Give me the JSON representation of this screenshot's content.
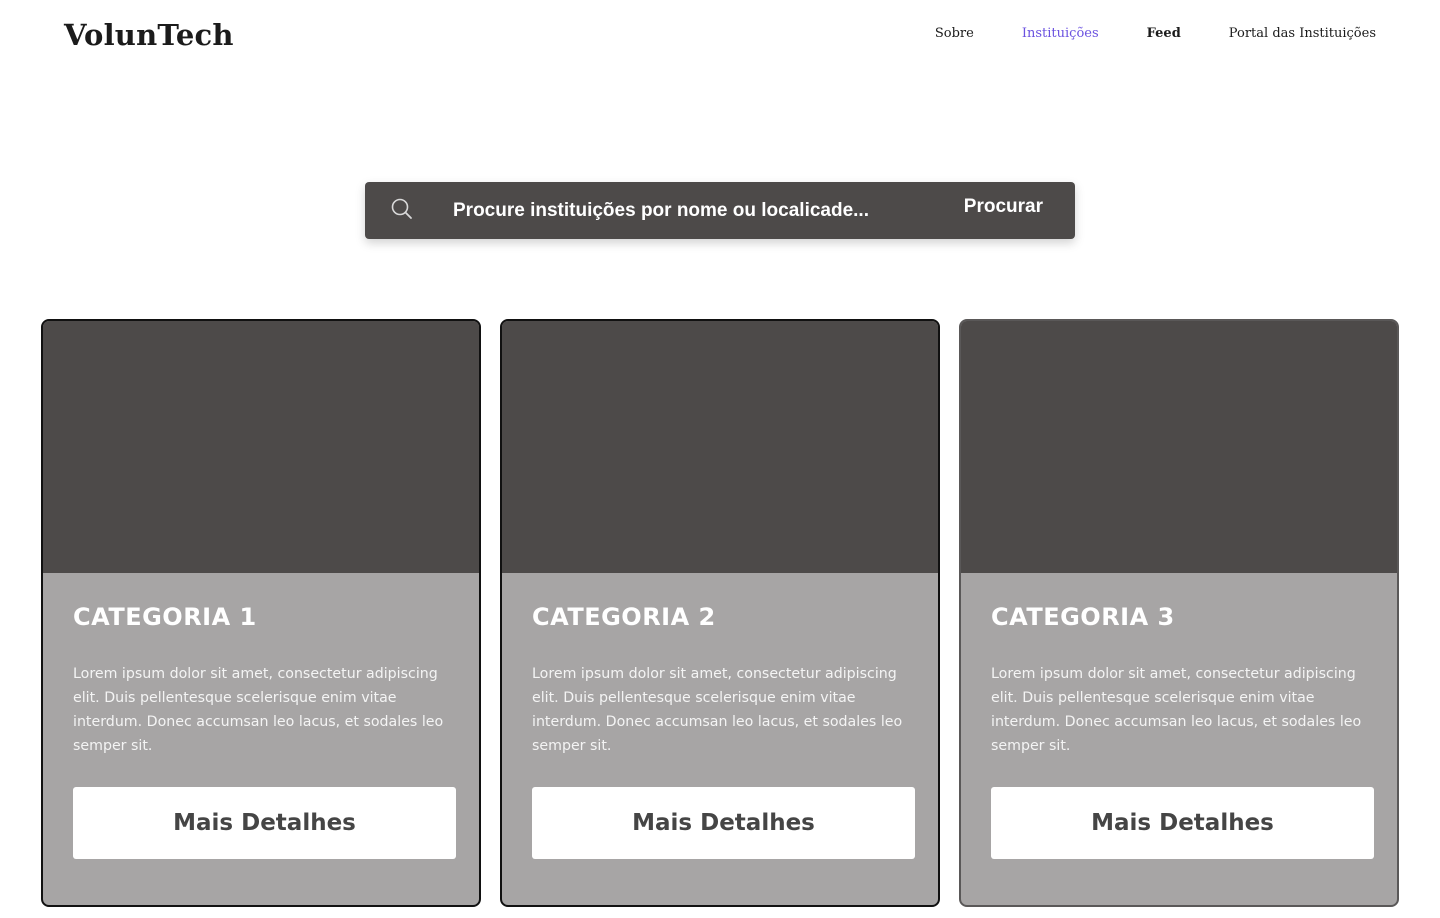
{
  "header": {
    "logo": "VolunTech",
    "nav": [
      {
        "label": "Sobre"
      },
      {
        "label": "Instituições"
      },
      {
        "label": "Feed"
      },
      {
        "label": "Portal das Instituições"
      }
    ]
  },
  "search": {
    "icon": "search-icon",
    "placeholder": "Procure instituições por nome ou localicade...",
    "button_label": "Procurar"
  },
  "cards": [
    {
      "title": "CATEGORIA 1",
      "text": "Lorem ipsum dolor sit amet, consectetur adipiscing elit. Duis  pellentesque scelerisque enim vitae interdum. Donec accumsan leo lacus,  et sodales leo semper sit.",
      "button_label": "Mais Detalhes"
    },
    {
      "title": "CATEGORIA 2",
      "text": "Lorem ipsum dolor sit amet, consectetur adipiscing elit. Duis  pellentesque scelerisque enim vitae interdum. Donec accumsan leo lacus,  et sodales leo semper sit.",
      "button_label": "Mais Detalhes"
    },
    {
      "title": "CATEGORIA 3",
      "text": "Lorem ipsum dolor sit amet, consectetur adipiscing elit. Duis  pellentesque scelerisque enim vitae interdum. Donec accumsan leo lacus,  et sodales leo semper sit.",
      "button_label": "Mais Detalhes"
    }
  ],
  "colors": {
    "accent": "#6b52e0",
    "dark": "#4d4a49",
    "card_body": "#a7a5a5"
  }
}
